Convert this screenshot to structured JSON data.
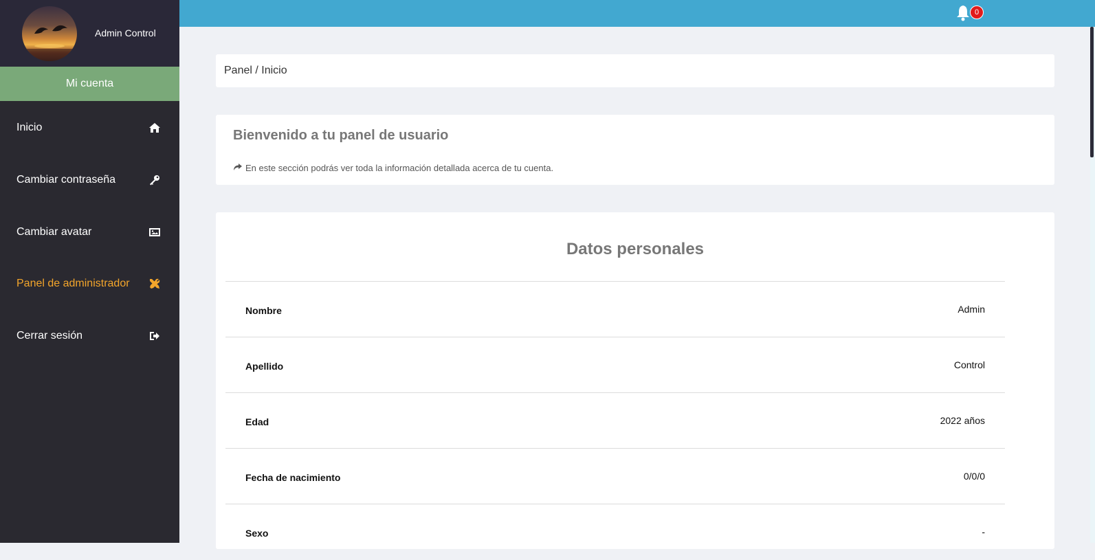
{
  "profile": {
    "name": "Admin Control"
  },
  "sidebar": {
    "account_label": "Mi cuenta",
    "items": [
      {
        "label": "Inicio",
        "icon": "home-icon"
      },
      {
        "label": "Cambiar contraseña",
        "icon": "key-icon"
      },
      {
        "label": "Cambiar avatar",
        "icon": "image-icon"
      },
      {
        "label": "Panel de administrador",
        "icon": "tools-icon"
      },
      {
        "label": "Cerrar sesión",
        "icon": "logout-icon"
      }
    ],
    "active_color": "#f3a52b"
  },
  "topbar": {
    "notification_count": "0"
  },
  "breadcrumb": "Panel / Inicio",
  "welcome": {
    "title": "Bienvenido a tu panel de usuario",
    "text": "En este sección podrás ver toda la información detallada acerca de tu cuenta."
  },
  "personal": {
    "title": "Datos personales",
    "rows": [
      {
        "label": "Nombre",
        "value": "Admin"
      },
      {
        "label": "Apellido",
        "value": "Control"
      },
      {
        "label": "Edad",
        "value": "2022 años"
      },
      {
        "label": "Fecha de nacimiento",
        "value": "0/0/0"
      },
      {
        "label": "Sexo",
        "value": "-"
      }
    ]
  },
  "colors": {
    "sidebar_bg": "#2a2930",
    "account_bg": "#7aa979",
    "topbar_bg": "#42a8d0"
  }
}
